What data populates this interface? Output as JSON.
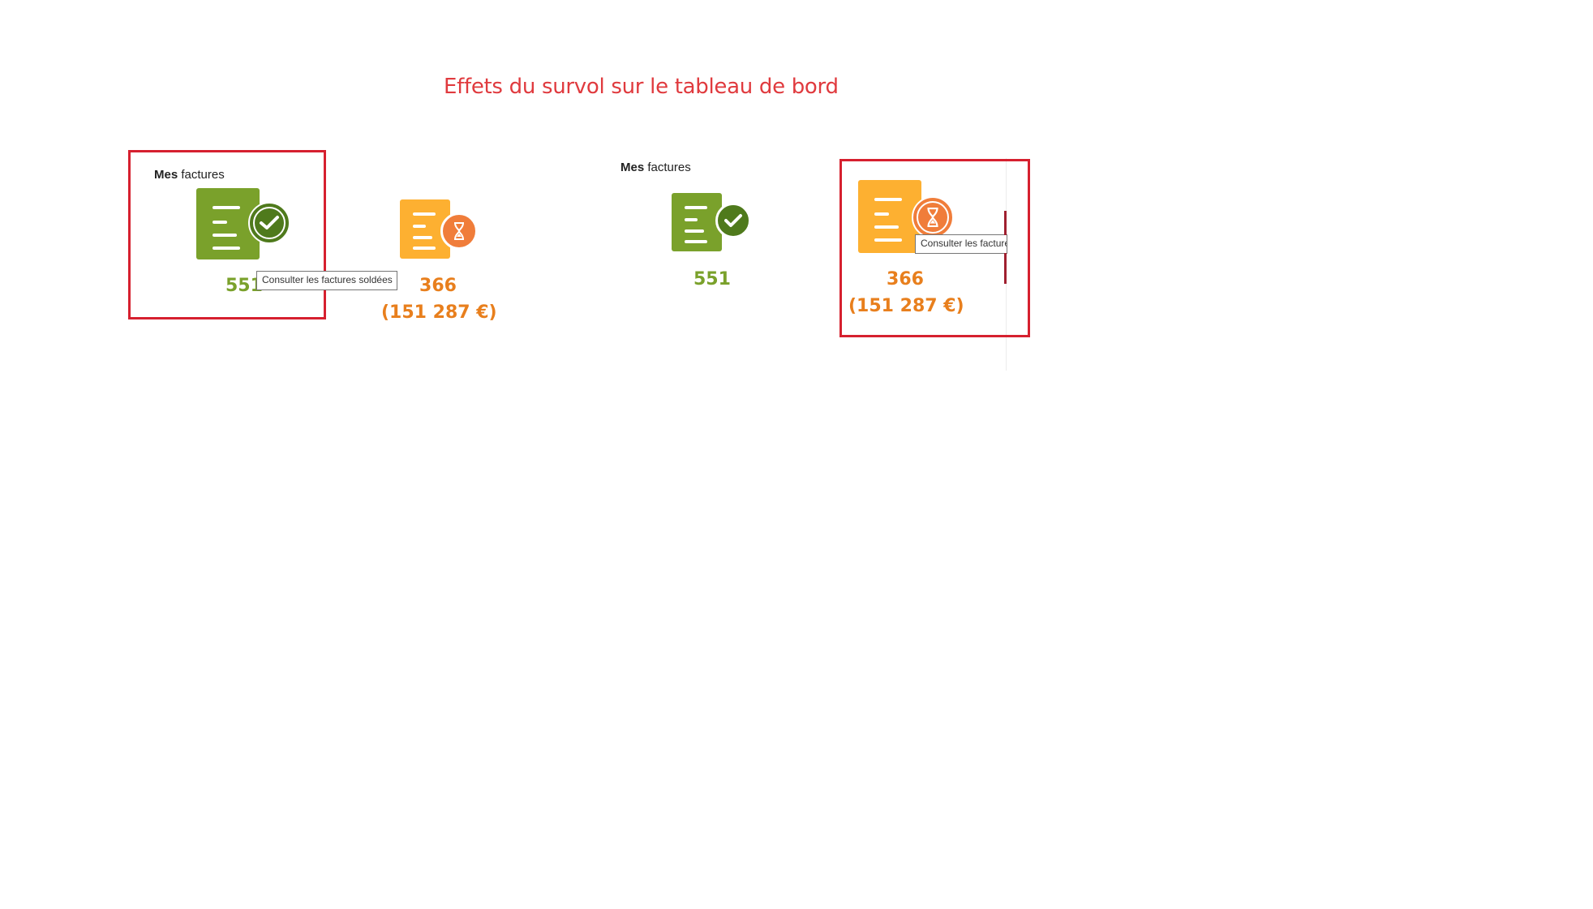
{
  "caption": "Effets du survol sur le tableau de bord",
  "panel_left": {
    "title_bold": "Mes",
    "title_rest": " factures",
    "paid": {
      "count": "551",
      "tooltip": "Consulter les factures soldées"
    },
    "pending": {
      "count": "366",
      "amount": "(151 287 €)"
    }
  },
  "panel_right": {
    "title_bold": "Mes",
    "title_rest": " factures",
    "paid": {
      "count": "551"
    },
    "pending": {
      "count": "366",
      "amount": "(151 287 €)",
      "tooltip": "Consulter les facture"
    }
  },
  "colors": {
    "highlight": "#d6202f",
    "paid_doc": "#7aa12b",
    "paid_badge": "#4f7a1c",
    "pending_doc": "#fdb031",
    "pending_badge": "#f07d3a",
    "caption": "#e03a3e"
  },
  "icons": {
    "paid": "invoice-paid-icon",
    "pending": "invoice-pending-icon",
    "check": "check-icon",
    "hourglass": "hourglass-icon"
  }
}
